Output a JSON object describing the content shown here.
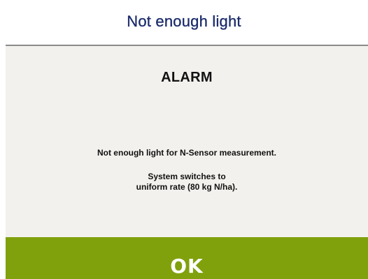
{
  "dialog": {
    "title": "Not enough light",
    "heading": "ALARM",
    "message_line_1": "Not enough light for N-Sensor measurement.",
    "message_line_2a": "System switches to",
    "message_line_2b": "uniform rate (80 kg N/ha).",
    "ok_label": "OK"
  },
  "colors": {
    "title_text": "#1a2b6b",
    "panel_background": "#f3f1ed",
    "ok_button_background": "#80a10c",
    "ok_button_text": "#ffffff"
  }
}
